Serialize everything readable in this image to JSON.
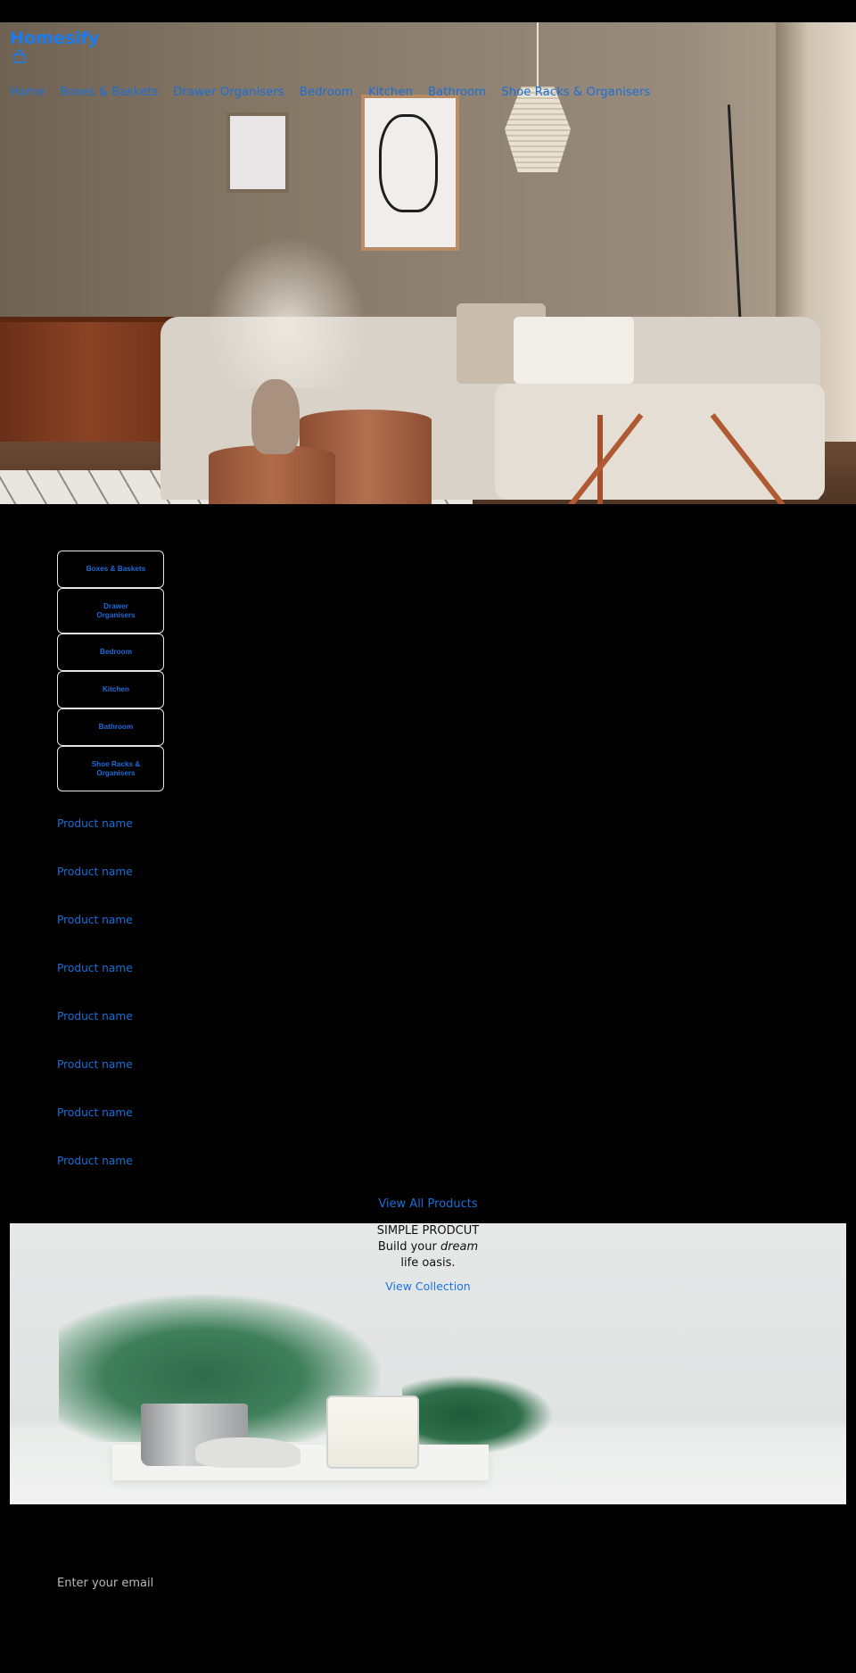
{
  "header": {
    "brand": "Homesify",
    "cart_icon": "shopping-bag-icon",
    "nav": [
      "Home",
      "Boxes & Baskets",
      "Drawer Organisers",
      "Bedroom",
      "Kitchen",
      "Bathroom",
      "Shoe Racks & Organisers"
    ]
  },
  "categories": [
    "Boxes & Baskets",
    "Drawer Organisers",
    "Bedroom",
    "Kitchen",
    "Bathroom",
    "Shoe Racks & Organisers"
  ],
  "products": [
    "Product name",
    "Product name",
    "Product name",
    "Product name",
    "Product name",
    "Product name",
    "Product name",
    "Product name"
  ],
  "view_all_label": "View All Products",
  "banner": {
    "eyebrow": "SIMPLE PRODCUT",
    "headline_before": "Build your ",
    "headline_emphasis": "dream",
    "headline_after": "life oasis.",
    "cta_label": "View Collection"
  },
  "newsletter": {
    "email_placeholder": "Enter your email"
  },
  "colors": {
    "background": "#000000",
    "link": "#1a73e8",
    "button_border": "#e6e6e6"
  }
}
